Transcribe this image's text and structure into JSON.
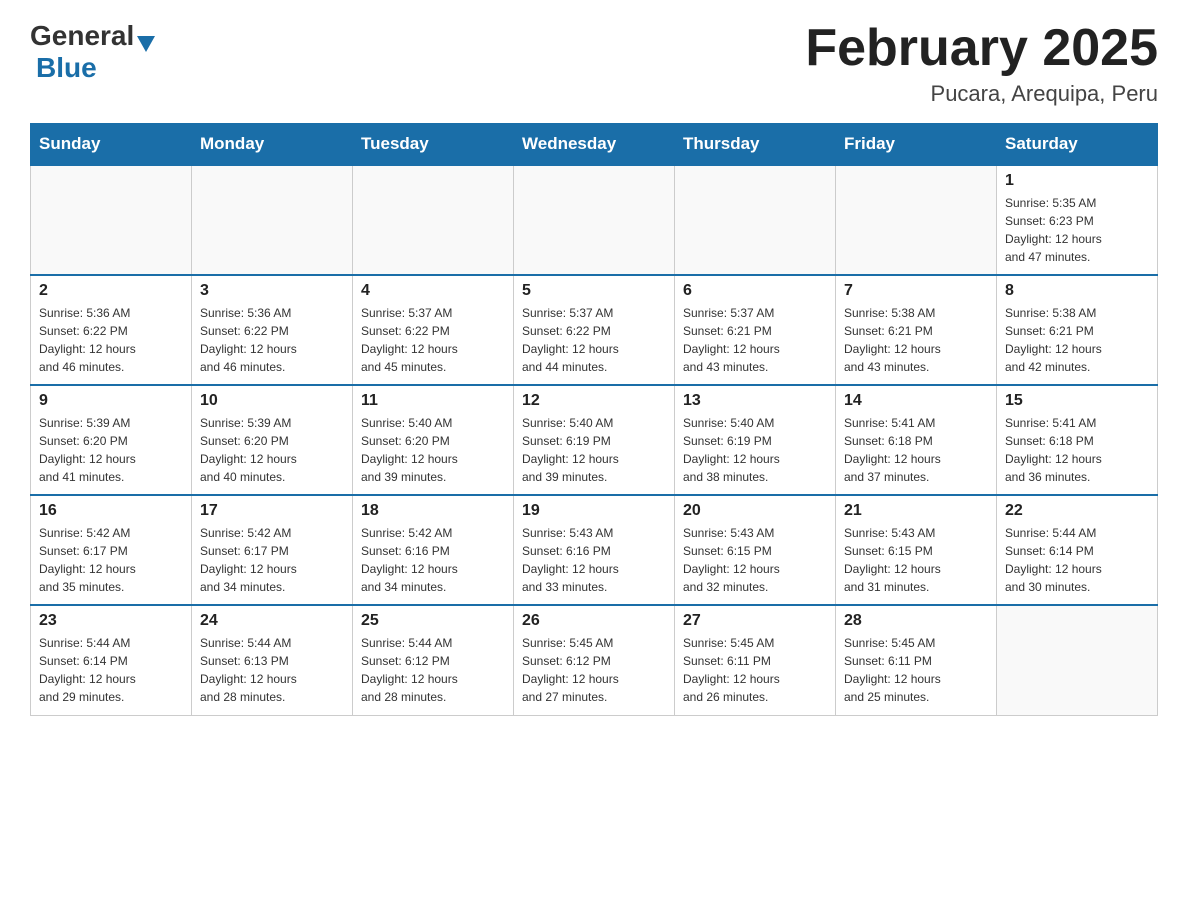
{
  "header": {
    "logo_general": "General",
    "logo_blue": "Blue",
    "title": "February 2025",
    "subtitle": "Pucara, Arequipa, Peru"
  },
  "weekdays": [
    "Sunday",
    "Monday",
    "Tuesday",
    "Wednesday",
    "Thursday",
    "Friday",
    "Saturday"
  ],
  "weeks": [
    [
      {
        "day": "",
        "info": ""
      },
      {
        "day": "",
        "info": ""
      },
      {
        "day": "",
        "info": ""
      },
      {
        "day": "",
        "info": ""
      },
      {
        "day": "",
        "info": ""
      },
      {
        "day": "",
        "info": ""
      },
      {
        "day": "1",
        "info": "Sunrise: 5:35 AM\nSunset: 6:23 PM\nDaylight: 12 hours\nand 47 minutes."
      }
    ],
    [
      {
        "day": "2",
        "info": "Sunrise: 5:36 AM\nSunset: 6:22 PM\nDaylight: 12 hours\nand 46 minutes."
      },
      {
        "day": "3",
        "info": "Sunrise: 5:36 AM\nSunset: 6:22 PM\nDaylight: 12 hours\nand 46 minutes."
      },
      {
        "day": "4",
        "info": "Sunrise: 5:37 AM\nSunset: 6:22 PM\nDaylight: 12 hours\nand 45 minutes."
      },
      {
        "day": "5",
        "info": "Sunrise: 5:37 AM\nSunset: 6:22 PM\nDaylight: 12 hours\nand 44 minutes."
      },
      {
        "day": "6",
        "info": "Sunrise: 5:37 AM\nSunset: 6:21 PM\nDaylight: 12 hours\nand 43 minutes."
      },
      {
        "day": "7",
        "info": "Sunrise: 5:38 AM\nSunset: 6:21 PM\nDaylight: 12 hours\nand 43 minutes."
      },
      {
        "day": "8",
        "info": "Sunrise: 5:38 AM\nSunset: 6:21 PM\nDaylight: 12 hours\nand 42 minutes."
      }
    ],
    [
      {
        "day": "9",
        "info": "Sunrise: 5:39 AM\nSunset: 6:20 PM\nDaylight: 12 hours\nand 41 minutes."
      },
      {
        "day": "10",
        "info": "Sunrise: 5:39 AM\nSunset: 6:20 PM\nDaylight: 12 hours\nand 40 minutes."
      },
      {
        "day": "11",
        "info": "Sunrise: 5:40 AM\nSunset: 6:20 PM\nDaylight: 12 hours\nand 39 minutes."
      },
      {
        "day": "12",
        "info": "Sunrise: 5:40 AM\nSunset: 6:19 PM\nDaylight: 12 hours\nand 39 minutes."
      },
      {
        "day": "13",
        "info": "Sunrise: 5:40 AM\nSunset: 6:19 PM\nDaylight: 12 hours\nand 38 minutes."
      },
      {
        "day": "14",
        "info": "Sunrise: 5:41 AM\nSunset: 6:18 PM\nDaylight: 12 hours\nand 37 minutes."
      },
      {
        "day": "15",
        "info": "Sunrise: 5:41 AM\nSunset: 6:18 PM\nDaylight: 12 hours\nand 36 minutes."
      }
    ],
    [
      {
        "day": "16",
        "info": "Sunrise: 5:42 AM\nSunset: 6:17 PM\nDaylight: 12 hours\nand 35 minutes."
      },
      {
        "day": "17",
        "info": "Sunrise: 5:42 AM\nSunset: 6:17 PM\nDaylight: 12 hours\nand 34 minutes."
      },
      {
        "day": "18",
        "info": "Sunrise: 5:42 AM\nSunset: 6:16 PM\nDaylight: 12 hours\nand 34 minutes."
      },
      {
        "day": "19",
        "info": "Sunrise: 5:43 AM\nSunset: 6:16 PM\nDaylight: 12 hours\nand 33 minutes."
      },
      {
        "day": "20",
        "info": "Sunrise: 5:43 AM\nSunset: 6:15 PM\nDaylight: 12 hours\nand 32 minutes."
      },
      {
        "day": "21",
        "info": "Sunrise: 5:43 AM\nSunset: 6:15 PM\nDaylight: 12 hours\nand 31 minutes."
      },
      {
        "day": "22",
        "info": "Sunrise: 5:44 AM\nSunset: 6:14 PM\nDaylight: 12 hours\nand 30 minutes."
      }
    ],
    [
      {
        "day": "23",
        "info": "Sunrise: 5:44 AM\nSunset: 6:14 PM\nDaylight: 12 hours\nand 29 minutes."
      },
      {
        "day": "24",
        "info": "Sunrise: 5:44 AM\nSunset: 6:13 PM\nDaylight: 12 hours\nand 28 minutes."
      },
      {
        "day": "25",
        "info": "Sunrise: 5:44 AM\nSunset: 6:12 PM\nDaylight: 12 hours\nand 28 minutes."
      },
      {
        "day": "26",
        "info": "Sunrise: 5:45 AM\nSunset: 6:12 PM\nDaylight: 12 hours\nand 27 minutes."
      },
      {
        "day": "27",
        "info": "Sunrise: 5:45 AM\nSunset: 6:11 PM\nDaylight: 12 hours\nand 26 minutes."
      },
      {
        "day": "28",
        "info": "Sunrise: 5:45 AM\nSunset: 6:11 PM\nDaylight: 12 hours\nand 25 minutes."
      },
      {
        "day": "",
        "info": ""
      }
    ]
  ]
}
